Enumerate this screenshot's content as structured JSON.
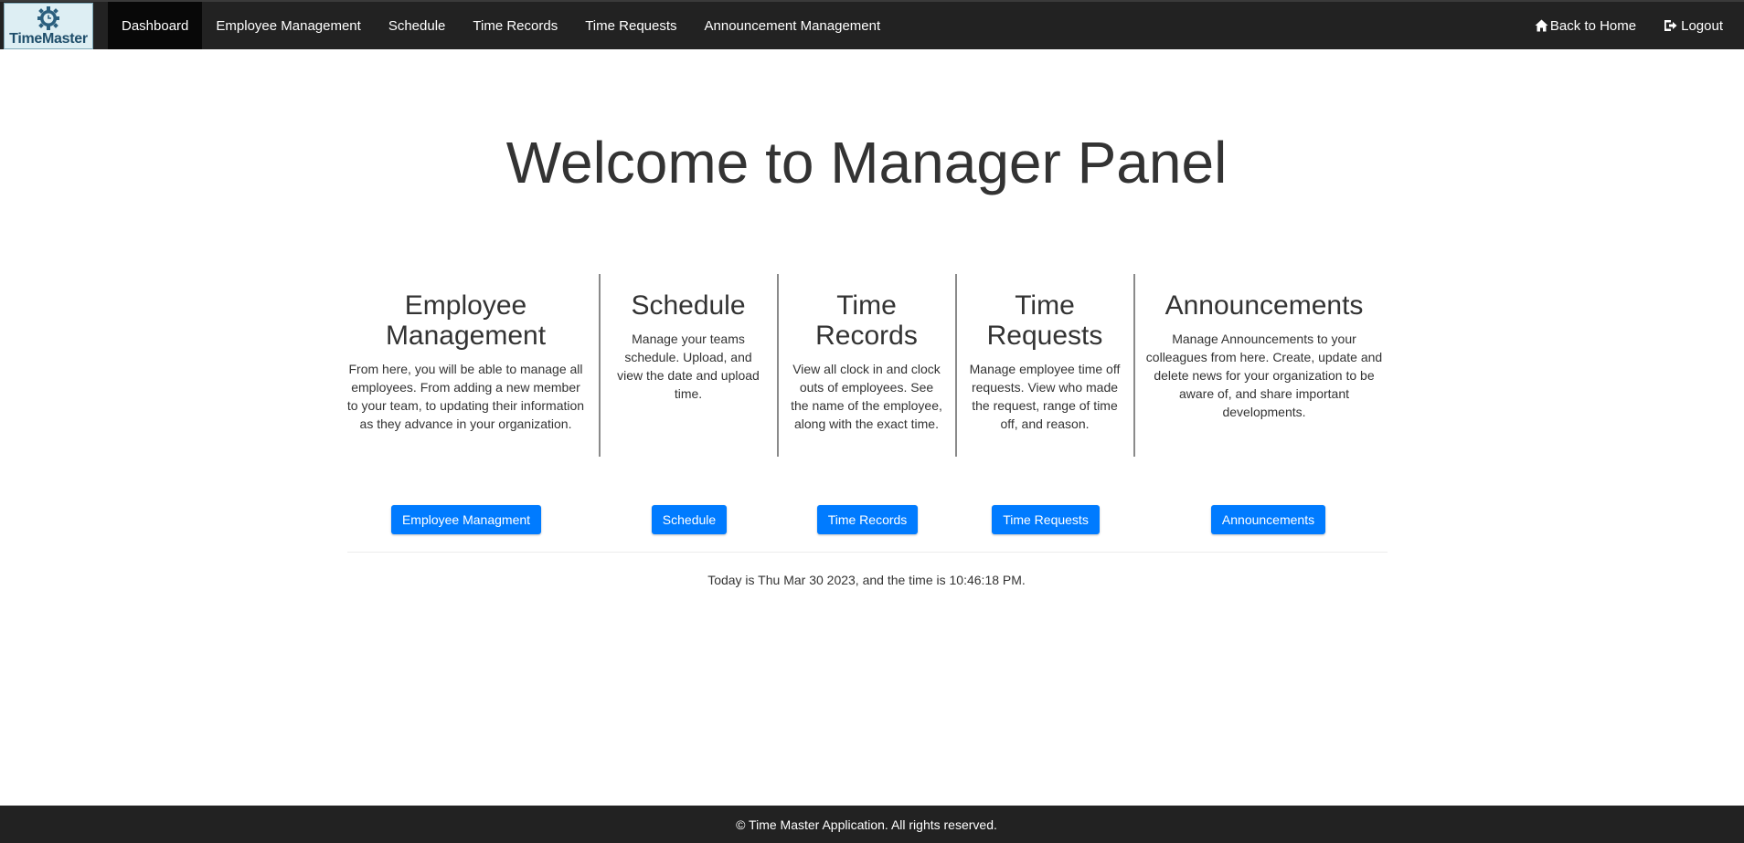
{
  "navbar": {
    "brand_text": "TimeMaster",
    "brand_icon": "gear-clock-icon",
    "items": [
      {
        "label": "Dashboard",
        "active": true
      },
      {
        "label": "Employee Management",
        "active": false
      },
      {
        "label": "Schedule",
        "active": false
      },
      {
        "label": "Time Records",
        "active": false
      },
      {
        "label": "Time Requests",
        "active": false
      },
      {
        "label": "Announcement Management",
        "active": false
      }
    ],
    "right": {
      "home_label": "Back to Home",
      "home_icon": "home-icon",
      "logout_label": "Logout",
      "logout_icon": "logout-icon"
    }
  },
  "hero": {
    "title": "Welcome to Manager Panel"
  },
  "features": [
    {
      "title": "Employee Management",
      "description": "From here, you will be able to manage all employees. From adding a new member to your team, to updating their information as they advance in your organization.",
      "button_label": "Employee Managment"
    },
    {
      "title": "Schedule",
      "description": "Manage your teams schedule. Upload, and view the date and upload time.",
      "button_label": "Schedule"
    },
    {
      "title": "Time Records",
      "description": "View all clock in and clock outs of employees. See the name of the employee, along with the exact time.",
      "button_label": "Time Records"
    },
    {
      "title": "Time Requests",
      "description": "Manage employee time off requests. View who made the request, range of time off, and reason.",
      "button_label": "Time Requests"
    },
    {
      "title": "Announcements",
      "description": "Manage Announcements to your colleagues from here. Create, update and delete news for your organization to be aware of, and share important developments.",
      "button_label": "Announcements"
    }
  ],
  "datetime_text": "Today is Thu Mar 30 2023, and the time is 10:46:18 PM.",
  "footer": {
    "text": "© Time Master Application. All rights reserved."
  },
  "colors": {
    "navbar_bg": "#222222",
    "navbar_active_bg": "#080808",
    "button_primary": "#007bff",
    "footer_bg": "#222222",
    "text": "#333333"
  }
}
